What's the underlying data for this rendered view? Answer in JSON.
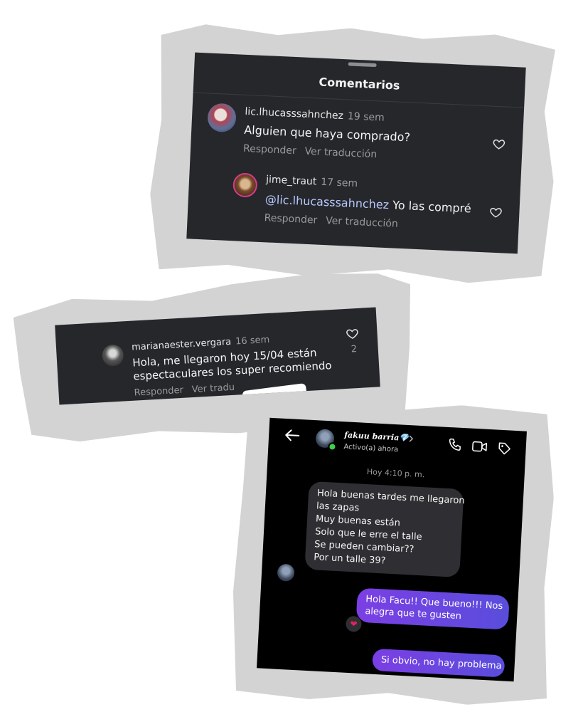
{
  "comments_panel": {
    "title": "Comentarios",
    "comments": [
      {
        "username": "lic.lhucasssahnchez",
        "time": "19 sem",
        "text": "Alguien que haya comprado?",
        "reply_label": "Responder",
        "translate_label": "Ver traducción"
      },
      {
        "username": "jime_traut",
        "time": "17 sem",
        "mention": "@lic.lhucasssahnchez",
        "text": "Yo las compré",
        "reply_label": "Responder",
        "translate_label": "Ver traducción"
      }
    ]
  },
  "comment_single": {
    "username": "marianaester.vergara",
    "time": "16 sem",
    "text_line1": "Hola, me llegaron hoy 15/04 están",
    "text_line2": "espectaculares  los super recomiendo",
    "like_count": "2",
    "reply_label": "Responder",
    "translate_label": "Ver tradu"
  },
  "dm": {
    "contact_name": "fakuu barria💎",
    "status": "Activo(a) ahora",
    "timestamp": "Hoy 4:10 p. m.",
    "incoming": [
      "Hola buenas tardes me llegaron",
      "las zapas",
      "Muy buenas están",
      "Solo que le erre el talle",
      "Se pueden cambiar??",
      "Por un talle 39?"
    ],
    "outgoing_1": [
      "Hola Facu!! Que bueno!!! Nos",
      "alegra que te gusten"
    ],
    "outgoing_2": "Si obvio, no hay problema",
    "reaction": "❤"
  },
  "colors": {
    "card_bg": "#25272b",
    "dm_bg": "#000000",
    "mention": "#b8c9ff",
    "outgoing_bubble": "#7b3fe4",
    "torn_paper": "#d3d3d3"
  }
}
